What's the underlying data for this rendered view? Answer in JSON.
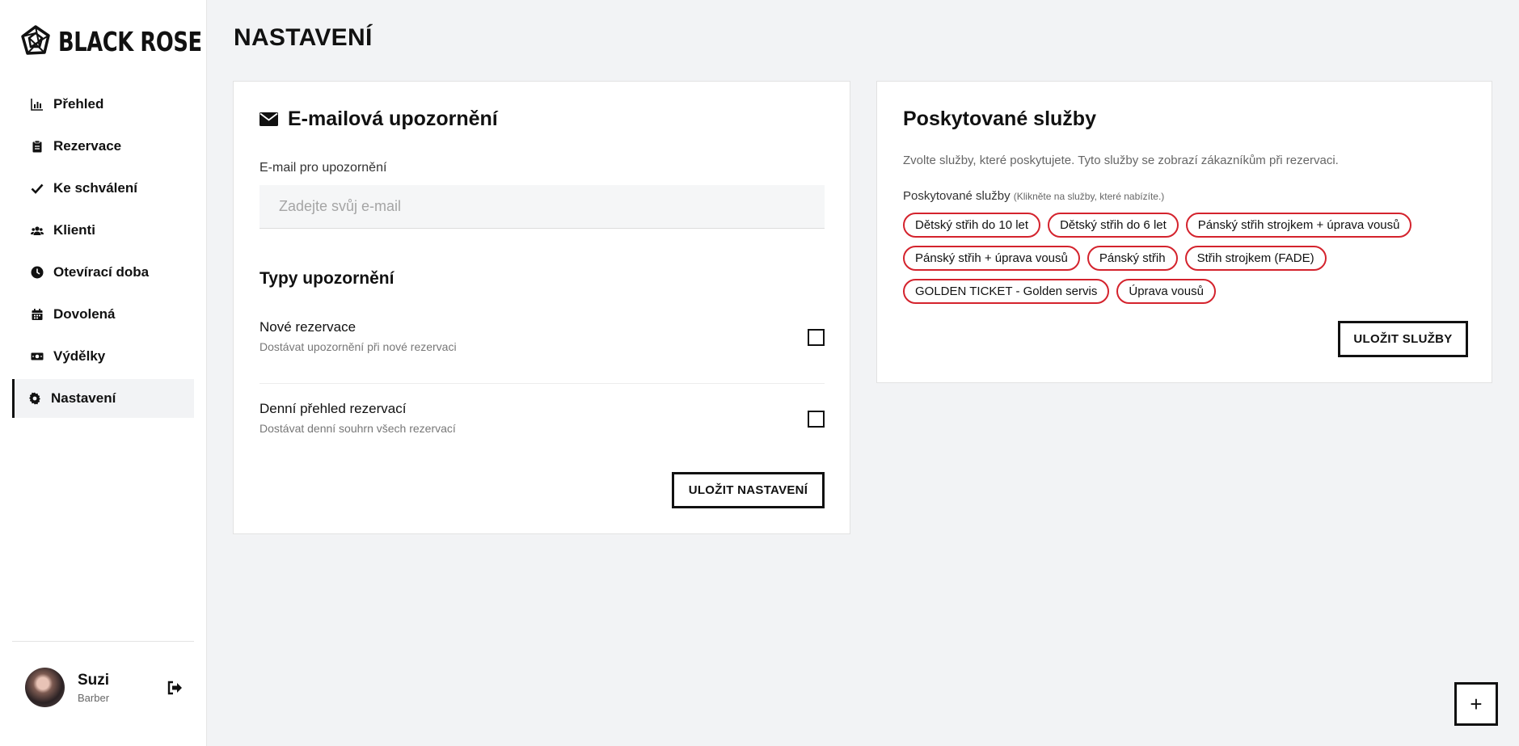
{
  "brand": {
    "name": "BLACK ROSE"
  },
  "page": {
    "title": "NASTAVENÍ"
  },
  "sidebar": {
    "items": [
      {
        "label": "Přehled",
        "icon": "bar-chart-icon"
      },
      {
        "label": "Rezervace",
        "icon": "clipboard-icon"
      },
      {
        "label": "Ke schválení",
        "icon": "check-icon"
      },
      {
        "label": "Klienti",
        "icon": "users-icon"
      },
      {
        "label": "Otevírací doba",
        "icon": "clock-icon"
      },
      {
        "label": "Dovolená",
        "icon": "calendar-icon"
      },
      {
        "label": "Výdělky",
        "icon": "money-icon"
      },
      {
        "label": "Nastavení",
        "icon": "gear-icon",
        "active": true
      }
    ]
  },
  "user": {
    "name": "Suzi",
    "role": "Barber"
  },
  "email_card": {
    "title": "E-mailová upozornění",
    "field_label": "E-mail pro upozornění",
    "email_value": "",
    "email_placeholder": "Zadejte svůj e-mail",
    "types_title": "Typy upozornění",
    "options": [
      {
        "title": "Nové rezervace",
        "description": "Dostávat upozornění při nové rezervaci",
        "checked": false
      },
      {
        "title": "Denní přehled rezervací",
        "description": "Dostávat denní souhrn všech rezervací",
        "checked": false
      }
    ],
    "save_label": "ULOŽIT NASTAVENÍ"
  },
  "services_card": {
    "title": "Poskytované služby",
    "description": "Zvolte služby, které poskytujete. Tyto služby se zobrazí zákazníkům při rezervaci.",
    "label": "Poskytované služby",
    "hint": "(Klikněte na služby, které nabízíte.)",
    "services": [
      "Dětský střih do 10 let",
      "Dětský střih do 6 let",
      "Pánský střih strojkem + úprava vousů",
      "Pánský střih + úprava vousů",
      "Pánský střih",
      "Střih strojkem (FADE)",
      "GOLDEN TICKET - Golden servis",
      "Úprava vousů"
    ],
    "chip_border_color": "#d4232d",
    "save_label": "ULOŽIT SLUŽBY"
  },
  "fab": {
    "label": "+"
  }
}
